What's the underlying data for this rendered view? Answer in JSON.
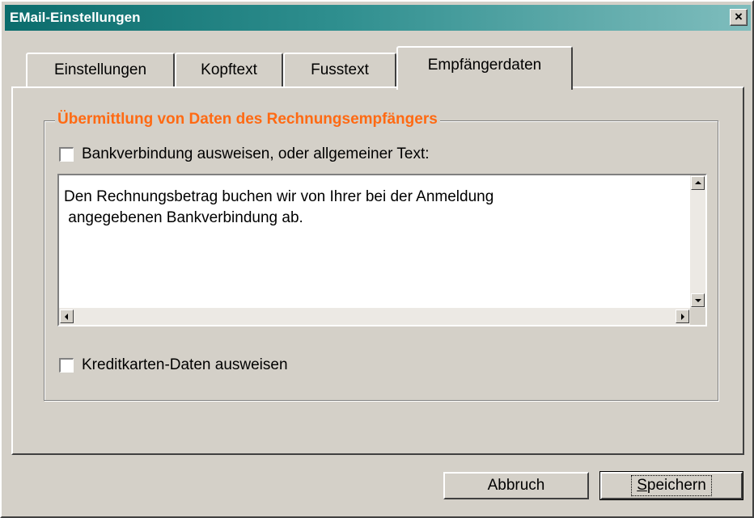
{
  "window": {
    "title": "EMail-Einstellungen",
    "close_label": "×"
  },
  "tabs": [
    {
      "label": "Einstellungen",
      "active": false
    },
    {
      "label": "Kopftext",
      "active": false
    },
    {
      "label": "Fusstext",
      "active": false
    },
    {
      "label": "Empfängerdaten",
      "active": true
    }
  ],
  "group": {
    "title": "Übermittlung von Daten des Rechnungsempfängers",
    "bank_checkbox_label": "Bankverbindung ausweisen, oder allgemeiner Text:",
    "bank_checked": false,
    "text_value": "Den Rechnungsbetrag buchen wir von Ihrer bei der Anmeldung\n angegebenen Bankverbindung ab.",
    "credit_checkbox_label": "Kreditkarten-Daten ausweisen",
    "credit_checked": false
  },
  "buttons": {
    "cancel_label": "Abbruch",
    "save_label": "Speichern"
  },
  "colors": {
    "titlebar": "#0b6c6c",
    "group_title": "#ff6a13",
    "face": "#d4d0c8"
  }
}
